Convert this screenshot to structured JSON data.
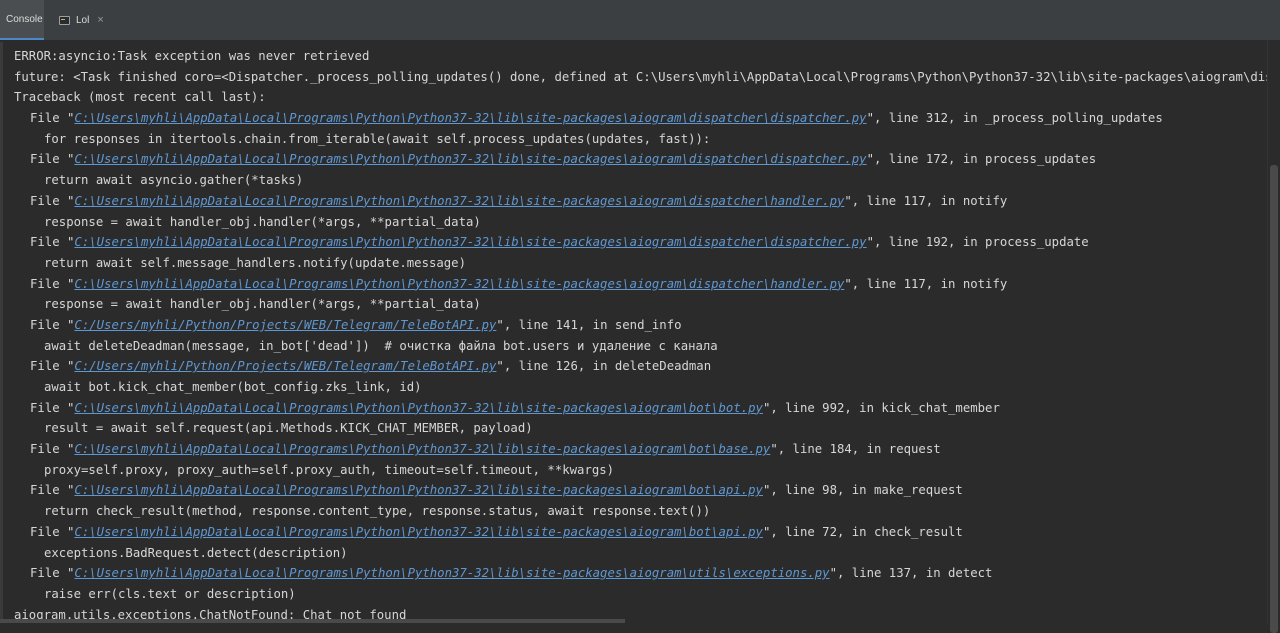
{
  "tabs": [
    {
      "label": "Console",
      "icon": "console-icon"
    },
    {
      "label": "Lol",
      "icon": "run-config-icon",
      "close": "×"
    }
  ],
  "colors": {
    "background": "#2b2b2b",
    "text": "#d6d6d6",
    "link": "#5f97d1",
    "accent": "#4a88c7"
  },
  "console_lines": [
    {
      "indent": 0,
      "text": "ERROR:asyncio:Task exception was never retrieved"
    },
    {
      "indent": 0,
      "text": "future: <Task finished coro=<Dispatcher._process_polling_updates() done, defined at C:\\Users\\myhli\\AppData\\Local\\Programs\\Python\\Python37-32\\lib\\site-packages\\aiogram\\dis"
    },
    {
      "indent": 0,
      "text": "Traceback (most recent call last):"
    },
    {
      "indent": 1,
      "pre": "File \"",
      "path": "C:\\Users\\myhli\\AppData\\Local\\Programs\\Python\\Python37-32\\lib\\site-packages\\aiogram\\dispatcher\\dispatcher.py",
      "post": "\", line 312, in _process_polling_updates"
    },
    {
      "indent": 2,
      "text": "for responses in itertools.chain.from_iterable(await self.process_updates(updates, fast)):"
    },
    {
      "indent": 1,
      "pre": "File \"",
      "path": "C:\\Users\\myhli\\AppData\\Local\\Programs\\Python\\Python37-32\\lib\\site-packages\\aiogram\\dispatcher\\dispatcher.py",
      "post": "\", line 172, in process_updates"
    },
    {
      "indent": 2,
      "text": "return await asyncio.gather(*tasks)"
    },
    {
      "indent": 1,
      "pre": "File \"",
      "path": "C:\\Users\\myhli\\AppData\\Local\\Programs\\Python\\Python37-32\\lib\\site-packages\\aiogram\\dispatcher\\handler.py",
      "post": "\", line 117, in notify"
    },
    {
      "indent": 2,
      "text": "response = await handler_obj.handler(*args, **partial_data)"
    },
    {
      "indent": 1,
      "pre": "File \"",
      "path": "C:\\Users\\myhli\\AppData\\Local\\Programs\\Python\\Python37-32\\lib\\site-packages\\aiogram\\dispatcher\\dispatcher.py",
      "post": "\", line 192, in process_update"
    },
    {
      "indent": 2,
      "text": "return await self.message_handlers.notify(update.message)"
    },
    {
      "indent": 1,
      "pre": "File \"",
      "path": "C:\\Users\\myhli\\AppData\\Local\\Programs\\Python\\Python37-32\\lib\\site-packages\\aiogram\\dispatcher\\handler.py",
      "post": "\", line 117, in notify"
    },
    {
      "indent": 2,
      "text": "response = await handler_obj.handler(*args, **partial_data)"
    },
    {
      "indent": 1,
      "pre": "File \"",
      "path": "C:/Users/myhli/Python/Projects/WEB/Telegram/TeleBotAPI.py",
      "post": "\", line 141, in send_info"
    },
    {
      "indent": 2,
      "text": "await deleteDeadman(message, in_bot['dead'])  # очистка файла bot.users и удаление с канала"
    },
    {
      "indent": 1,
      "pre": "File \"",
      "path": "C:/Users/myhli/Python/Projects/WEB/Telegram/TeleBotAPI.py",
      "post": "\", line 126, in deleteDeadman"
    },
    {
      "indent": 2,
      "text": "await bot.kick_chat_member(bot_config.zks_link, id)"
    },
    {
      "indent": 1,
      "pre": "File \"",
      "path": "C:\\Users\\myhli\\AppData\\Local\\Programs\\Python\\Python37-32\\lib\\site-packages\\aiogram\\bot\\bot.py",
      "post": "\", line 992, in kick_chat_member"
    },
    {
      "indent": 2,
      "text": "result = await self.request(api.Methods.KICK_CHAT_MEMBER, payload)"
    },
    {
      "indent": 1,
      "pre": "File \"",
      "path": "C:\\Users\\myhli\\AppData\\Local\\Programs\\Python\\Python37-32\\lib\\site-packages\\aiogram\\bot\\base.py",
      "post": "\", line 184, in request"
    },
    {
      "indent": 2,
      "text": "proxy=self.proxy, proxy_auth=self.proxy_auth, timeout=self.timeout, **kwargs)"
    },
    {
      "indent": 1,
      "pre": "File \"",
      "path": "C:\\Users\\myhli\\AppData\\Local\\Programs\\Python\\Python37-32\\lib\\site-packages\\aiogram\\bot\\api.py",
      "post": "\", line 98, in make_request"
    },
    {
      "indent": 2,
      "text": "return check_result(method, response.content_type, response.status, await response.text())"
    },
    {
      "indent": 1,
      "pre": "File \"",
      "path": "C:\\Users\\myhli\\AppData\\Local\\Programs\\Python\\Python37-32\\lib\\site-packages\\aiogram\\bot\\api.py",
      "post": "\", line 72, in check_result"
    },
    {
      "indent": 2,
      "text": "exceptions.BadRequest.detect(description)"
    },
    {
      "indent": 1,
      "pre": "File \"",
      "path": "C:\\Users\\myhli\\AppData\\Local\\Programs\\Python\\Python37-32\\lib\\site-packages\\aiogram\\utils\\exceptions.py",
      "post": "\", line 137, in detect"
    },
    {
      "indent": 2,
      "text": "raise err(cls.text or description)"
    },
    {
      "indent": 0,
      "text": "aiogram.utils.exceptions.ChatNotFound: Chat not found"
    }
  ]
}
